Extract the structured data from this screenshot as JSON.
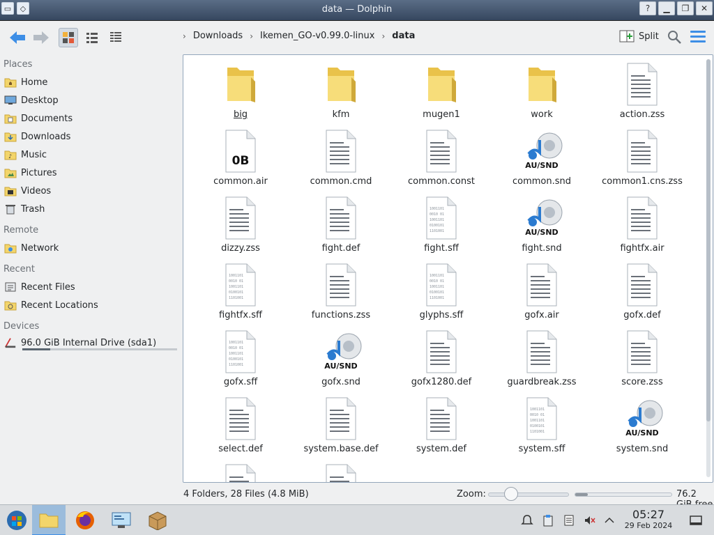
{
  "window": {
    "title": "data — Dolphin"
  },
  "toolbar": {
    "breadcrumb": [
      "Downloads",
      "Ikemen_GO-v0.99.0-linux",
      "data"
    ],
    "split_label": "Split"
  },
  "sidebar": {
    "sections": {
      "places": "Places",
      "remote": "Remote",
      "recent": "Recent",
      "devices": "Devices"
    },
    "places": [
      {
        "label": "Home",
        "icon": "home-folder-icon"
      },
      {
        "label": "Desktop",
        "icon": "desktop-folder-icon"
      },
      {
        "label": "Documents",
        "icon": "documents-folder-icon"
      },
      {
        "label": "Downloads",
        "icon": "downloads-folder-icon"
      },
      {
        "label": "Music",
        "icon": "music-folder-icon"
      },
      {
        "label": "Pictures",
        "icon": "pictures-folder-icon"
      },
      {
        "label": "Videos",
        "icon": "videos-folder-icon"
      },
      {
        "label": "Trash",
        "icon": "trash-icon"
      }
    ],
    "remote": [
      {
        "label": "Network",
        "icon": "network-folder-icon"
      }
    ],
    "recent": [
      {
        "label": "Recent Files",
        "icon": "recent-files-icon"
      },
      {
        "label": "Recent Locations",
        "icon": "recent-locations-icon"
      }
    ],
    "devices": [
      {
        "label": "96.0 GiB Internal Drive (sda1)",
        "icon": "drive-icon",
        "usage_fraction": 0.18
      }
    ]
  },
  "files": [
    {
      "name": "big",
      "type": "folder"
    },
    {
      "name": "kfm",
      "type": "folder"
    },
    {
      "name": "mugen1",
      "type": "folder"
    },
    {
      "name": "work",
      "type": "folder"
    },
    {
      "name": "action.zss",
      "type": "text"
    },
    {
      "name": "common.air",
      "type": "empty",
      "badge": "0B"
    },
    {
      "name": "common.cmd",
      "type": "text"
    },
    {
      "name": "common.const",
      "type": "text"
    },
    {
      "name": "common.snd",
      "type": "audio",
      "badge": "AU/SND"
    },
    {
      "name": "common1.cns.zss",
      "type": "text"
    },
    {
      "name": "dizzy.zss",
      "type": "text"
    },
    {
      "name": "fight.def",
      "type": "text"
    },
    {
      "name": "fight.sff",
      "type": "binary"
    },
    {
      "name": "fight.snd",
      "type": "audio",
      "badge": "AU/SND"
    },
    {
      "name": "fightfx.air",
      "type": "text"
    },
    {
      "name": "fightfx.sff",
      "type": "binary"
    },
    {
      "name": "functions.zss",
      "type": "text"
    },
    {
      "name": "glyphs.sff",
      "type": "binary"
    },
    {
      "name": "gofx.air",
      "type": "text"
    },
    {
      "name": "gofx.def",
      "type": "text"
    },
    {
      "name": "gofx.sff",
      "type": "binary"
    },
    {
      "name": "gofx.snd",
      "type": "audio",
      "badge": "AU/SND"
    },
    {
      "name": "gofx1280.def",
      "type": "text"
    },
    {
      "name": "guardbreak.zss",
      "type": "text"
    },
    {
      "name": "score.zss",
      "type": "text"
    },
    {
      "name": "select.def",
      "type": "text"
    },
    {
      "name": "system.base.def",
      "type": "text"
    },
    {
      "name": "system.def",
      "type": "text"
    },
    {
      "name": "system.sff",
      "type": "binary"
    },
    {
      "name": "system.snd",
      "type": "audio",
      "badge": "AU/SND"
    },
    {
      "name": "",
      "type": "text"
    },
    {
      "name": "",
      "type": "text"
    }
  ],
  "statusbar": {
    "count": "4 Folders, 28 Files (4.8 MiB)",
    "zoom_label": "Zoom:",
    "zoom_fraction": 0.2,
    "free": "76.2 GiB free",
    "used_fraction": 0.13
  },
  "taskbar": {
    "time": "05:27",
    "date": "29 Feb 2024"
  },
  "colors": {
    "accent": "#3d8ee6",
    "folder": "#f3d56b",
    "selection": "#9bbcdc"
  }
}
